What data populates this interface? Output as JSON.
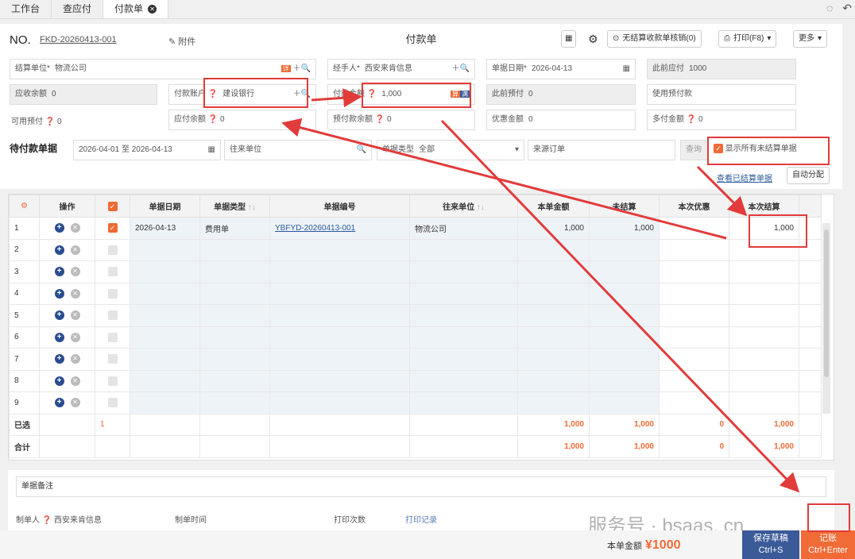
{
  "tabs": [
    {
      "label": "工作台"
    },
    {
      "label": "查应付"
    },
    {
      "label": "付款单"
    }
  ],
  "header": {
    "no_label": "NO.",
    "no_value": "FKD-20260413-001",
    "attach": "附件",
    "title": "付款单",
    "unsettled_btn": "无结算收款单核销(0)",
    "print_btn": "打印(F8)",
    "more_btn": "更多"
  },
  "form": {
    "settle_unit_label": "结算单位*",
    "settle_unit_value": "物流公司",
    "handler_label": "经手人*",
    "handler_value": "西安来肯信息",
    "doc_date_label": "单据日期*",
    "doc_date_value": "2026-04-13",
    "prev_payable_label": "此前应付",
    "prev_payable_value": "1000",
    "receivable_bal_label": "应收余额",
    "receivable_bal_value": "0",
    "pay_account_label": "付款账户",
    "pay_account_value": "建设银行",
    "pay_amount_label": "付款金额",
    "pay_amount_value": "1,000",
    "prev_prepay_label": "此前预付",
    "prev_prepay_value": "0",
    "use_prepay_label": "使用预付款",
    "avail_prepay_label": "可用预付",
    "avail_prepay_value": "0",
    "payable_bal_label": "应付余额",
    "payable_bal_value": "0",
    "prepay_bal_label": "预付款余额",
    "prepay_bal_value": "0",
    "discount_label": "优惠金额",
    "discount_value": "0",
    "overpay_label": "多付金额",
    "overpay_value": "0"
  },
  "filter": {
    "section_title": "待付款单据",
    "date_from": "2026-04-01",
    "date_sep": "至",
    "date_to": "2026-04-13",
    "partner_placeholder": "往来单位",
    "doc_type_label": "单据类型",
    "doc_type_value": "全部",
    "source_placeholder": "来源订单",
    "query_btn": "查询",
    "show_all_label": "显示所有未结算单据",
    "view_settled": "查看已结算单据",
    "auto_alloc": "自动分配"
  },
  "table": {
    "headers": [
      "操作",
      "单据日期",
      "单据类型",
      "单据编号",
      "往来单位",
      "本单金额",
      "未结算",
      "本次优惠",
      "本次结算"
    ],
    "rows": [
      {
        "idx": "1",
        "checked": true,
        "date": "2026-04-13",
        "type": "费用单",
        "code": "YBFYD-20260413-001",
        "partner": "物流公司",
        "amount": "1,000",
        "unsettled": "1,000",
        "discount": "",
        "settle": "1,000"
      },
      {
        "idx": "2"
      },
      {
        "idx": "3"
      },
      {
        "idx": "4"
      },
      {
        "idx": "5"
      },
      {
        "idx": "6"
      },
      {
        "idx": "7"
      },
      {
        "idx": "8"
      },
      {
        "idx": "9"
      }
    ],
    "selected_label": "已选",
    "selected_count": "1",
    "selected_amount": "1,000",
    "selected_unsettled": "1,000",
    "selected_discount": "0",
    "selected_settle": "1,000",
    "total_label": "合计",
    "total_amount": "1,000",
    "total_unsettled": "1,000",
    "total_discount": "0",
    "total_settle": "1,000"
  },
  "footer": {
    "note_label": "单据备注",
    "maker_label": "制单人",
    "maker_value": "西安来肯信息",
    "make_time_label": "制单时间",
    "print_count_label": "打印次数",
    "print_record": "打印记录"
  },
  "bottom": {
    "total_label": "本单金额",
    "total_value": "¥1000",
    "save_btn": "保存草稿",
    "save_key": "Ctrl+S",
    "post_btn": "记账",
    "post_key": "Ctrl+Enter"
  },
  "watermark": "服务号 · bsaas. cn",
  "colors": {
    "accent": "#f06b35",
    "primary": "#3a5a98",
    "annotation": "#e23b3b"
  }
}
